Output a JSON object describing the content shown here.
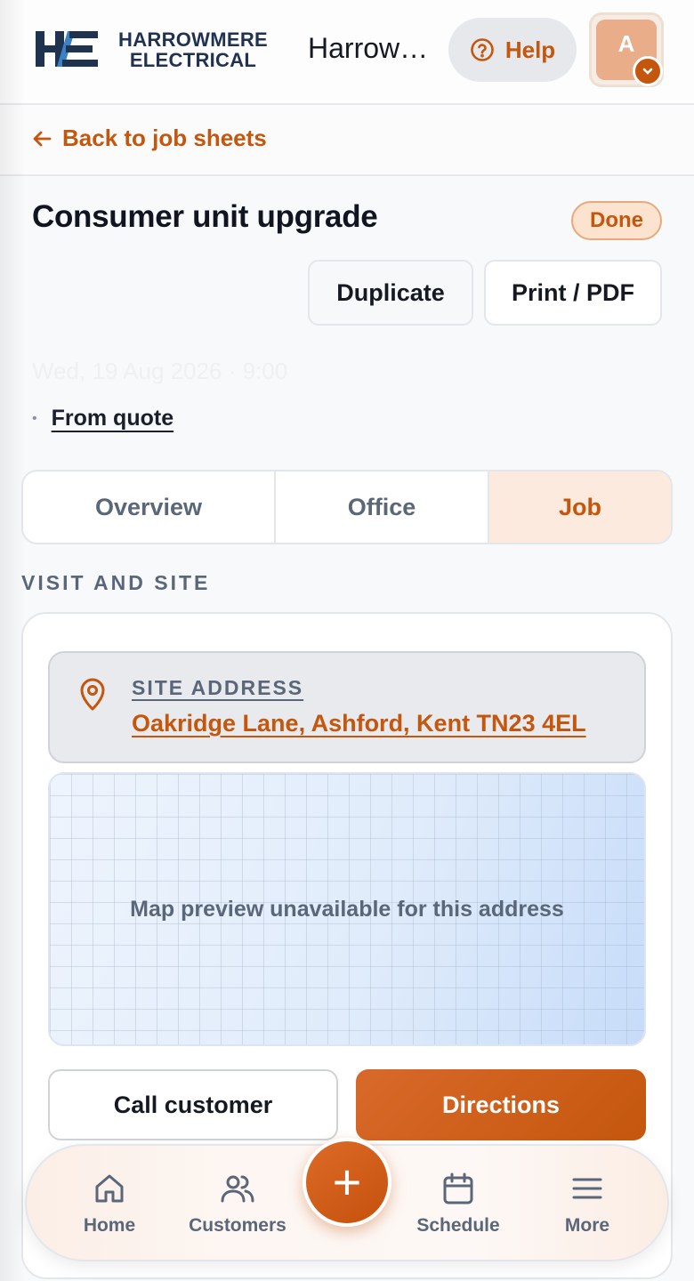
{
  "header": {
    "brand_line1": "HARROWMERE",
    "brand_line2": "ELECTRICAL",
    "title": "Harrowmere Electrical",
    "help_label": "Help",
    "avatar_initial": "A"
  },
  "nav_back": {
    "label": "Back to job sheets"
  },
  "job": {
    "title": "Consumer unit upgrade",
    "status": "Done",
    "duplicate_label": "Duplicate",
    "print_label": "Print / PDF",
    "date": "Wed, 19 Aug 2026 · 9:00",
    "source_link": "From quote"
  },
  "tabs": [
    {
      "label": "Overview",
      "active": false
    },
    {
      "label": "Office",
      "active": false
    },
    {
      "label": "Job",
      "active": true
    }
  ],
  "section": {
    "heading": "VISIT AND SITE",
    "address_label": "SITE ADDRESS",
    "address_value": "Oakridge Lane, Ashford, Kent TN23 4EL",
    "map_message": "Map preview unavailable for this address",
    "call_label": "Call customer",
    "directions_label": "Directions"
  },
  "bottom_nav": {
    "home": "Home",
    "customers": "Customers",
    "add": "+",
    "schedule": "Schedule",
    "more": "More"
  },
  "colors": {
    "accent": "#c4570d",
    "brand_navy": "#1f3350",
    "muted": "#5a6778"
  }
}
